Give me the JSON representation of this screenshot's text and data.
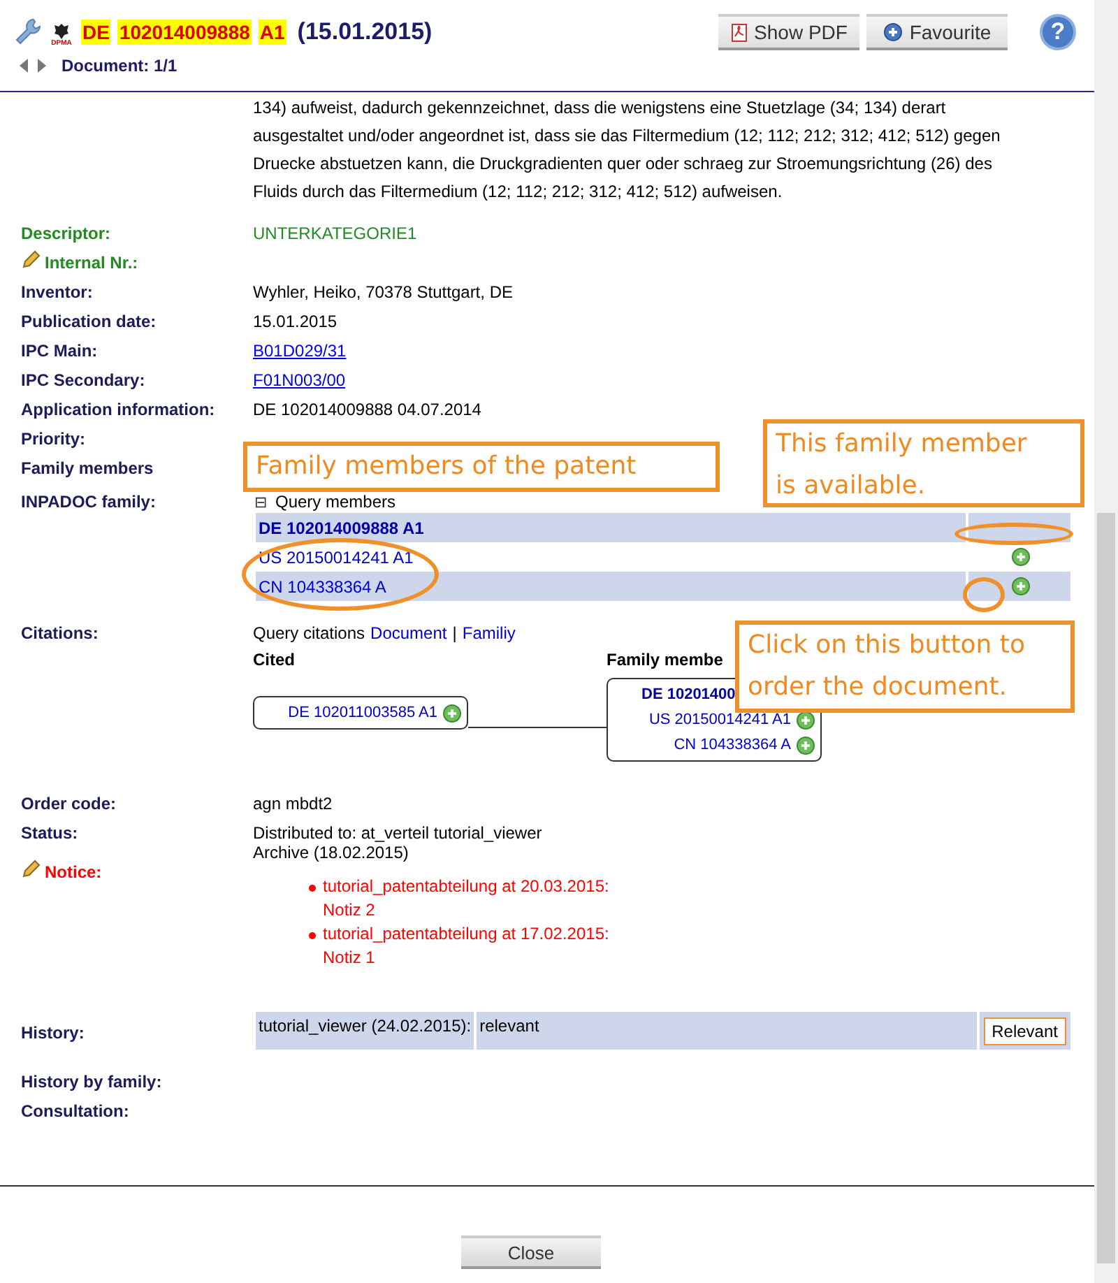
{
  "header": {
    "logo_text": "DPMA",
    "title_parts": [
      {
        "text": "DE",
        "highlight": true
      },
      {
        "text": "102014009888",
        "highlight": true
      },
      {
        "text": "A1",
        "highlight": true
      },
      {
        "text": "(15.01.2015)",
        "highlight": false
      }
    ],
    "document": "Document: 1/1",
    "buttons": [
      {
        "label": "Show PDF",
        "kind": "pdf"
      },
      {
        "label": "Favourite",
        "kind": "favourite"
      }
    ],
    "help": "?"
  },
  "abstract_lines": [
    "134) aufweist, dadurch gekennzeichnet, dass die wenigstens eine Stuetzlage (34; 134) derart",
    "ausgestaltet und/oder angeordnet ist, dass sie das Filtermedium (12; 112; 212; 312; 412; 512) gegen",
    "Druecke abstuetzen kann, die Druckgradienten quer oder schraeg zur Stroemungsrichtung (26) des",
    "Fluids durch das Filtermedium (12; 112; 212; 312; 412; 512) aufweisen."
  ],
  "fields": [
    {
      "kind": "descriptor",
      "label": "Descriptor:",
      "value": "UNTERKATEGORIE1"
    },
    {
      "kind": "note",
      "label": "Internal Nr.:",
      "color": "#228b22"
    },
    {
      "kind": "text",
      "label": "Inventor:",
      "lines": [
        "Wyhler, Heiko, 70378 Stuttgart, DE"
      ]
    },
    {
      "kind": "text",
      "label": "Publication date:",
      "lines": [
        "15.01.2015"
      ]
    },
    {
      "kind": "link",
      "label": "IPC Main:",
      "value": "B01D029/31"
    },
    {
      "kind": "link",
      "label": "IPC Secondary:",
      "value": "F01N003/00"
    },
    {
      "kind": "text",
      "label": "Application information:",
      "lines": [
        "DE 102014009888 04.07.2014"
      ]
    },
    {
      "kind": "text",
      "label": "Priority:"
    },
    {
      "kind": "text",
      "label": "Family members"
    },
    {
      "kind": "inpadoc",
      "label": "INPADOC family:",
      "toggle": "⊟",
      "query": "Query members",
      "members": [
        {
          "text": "DE 102014009888 A1",
          "current": true,
          "available": false
        },
        {
          "text": "US 20150014241 A1",
          "current": false,
          "available": true
        },
        {
          "text": "CN 104338364 A",
          "current": false,
          "available": true
        }
      ]
    },
    {
      "kind": "citations",
      "label": "Citations:",
      "prefix": "Query citations",
      "links": [
        "Document",
        "Familiy"
      ],
      "separator": "|",
      "cited_heading": "Cited",
      "cited": [
        {
          "text": "DE 102011003585 A1",
          "available": true
        }
      ],
      "family_heading": "Family membe",
      "family": [
        {
          "text": "DE 10201400",
          "current": true
        },
        {
          "text": "US 20150014241 A1",
          "current": false,
          "available": true
        },
        {
          "text": "CN 104338364 A",
          "current": false,
          "available": true
        }
      ]
    },
    {
      "kind": "text",
      "label": "Order code:",
      "lines": [
        "agn mbdt2"
      ]
    },
    {
      "kind": "text",
      "label": "Status:",
      "lines": [
        "Distributed to: at_verteil tutorial_viewer",
        "Archive (18.02.2015)"
      ]
    },
    {
      "kind": "notice",
      "label": "Notice:",
      "color": "#ff0000",
      "items": [
        [
          "tutorial_patentabteilung at 20.03.2015:",
          "Notiz 2"
        ],
        [
          "tutorial_patentabteilung at 17.02.2015:",
          "Notiz 1"
        ]
      ]
    },
    {
      "kind": "history",
      "label": "History:",
      "cells": [
        "tutorial_viewer (24.02.2015):",
        "relevant"
      ],
      "button": "Relevant"
    },
    {
      "kind": "text",
      "label": "History by family:"
    },
    {
      "kind": "text",
      "label": "Consultation:"
    }
  ],
  "callouts": [
    {
      "kind": "members",
      "lines": [
        "Family members of the patent"
      ]
    },
    {
      "kind": "available",
      "lines": [
        "This family member",
        "is available."
      ]
    },
    {
      "kind": "order",
      "lines": [
        "Click on this button to",
        "order the document."
      ]
    }
  ],
  "footer": {
    "button": "Close"
  }
}
